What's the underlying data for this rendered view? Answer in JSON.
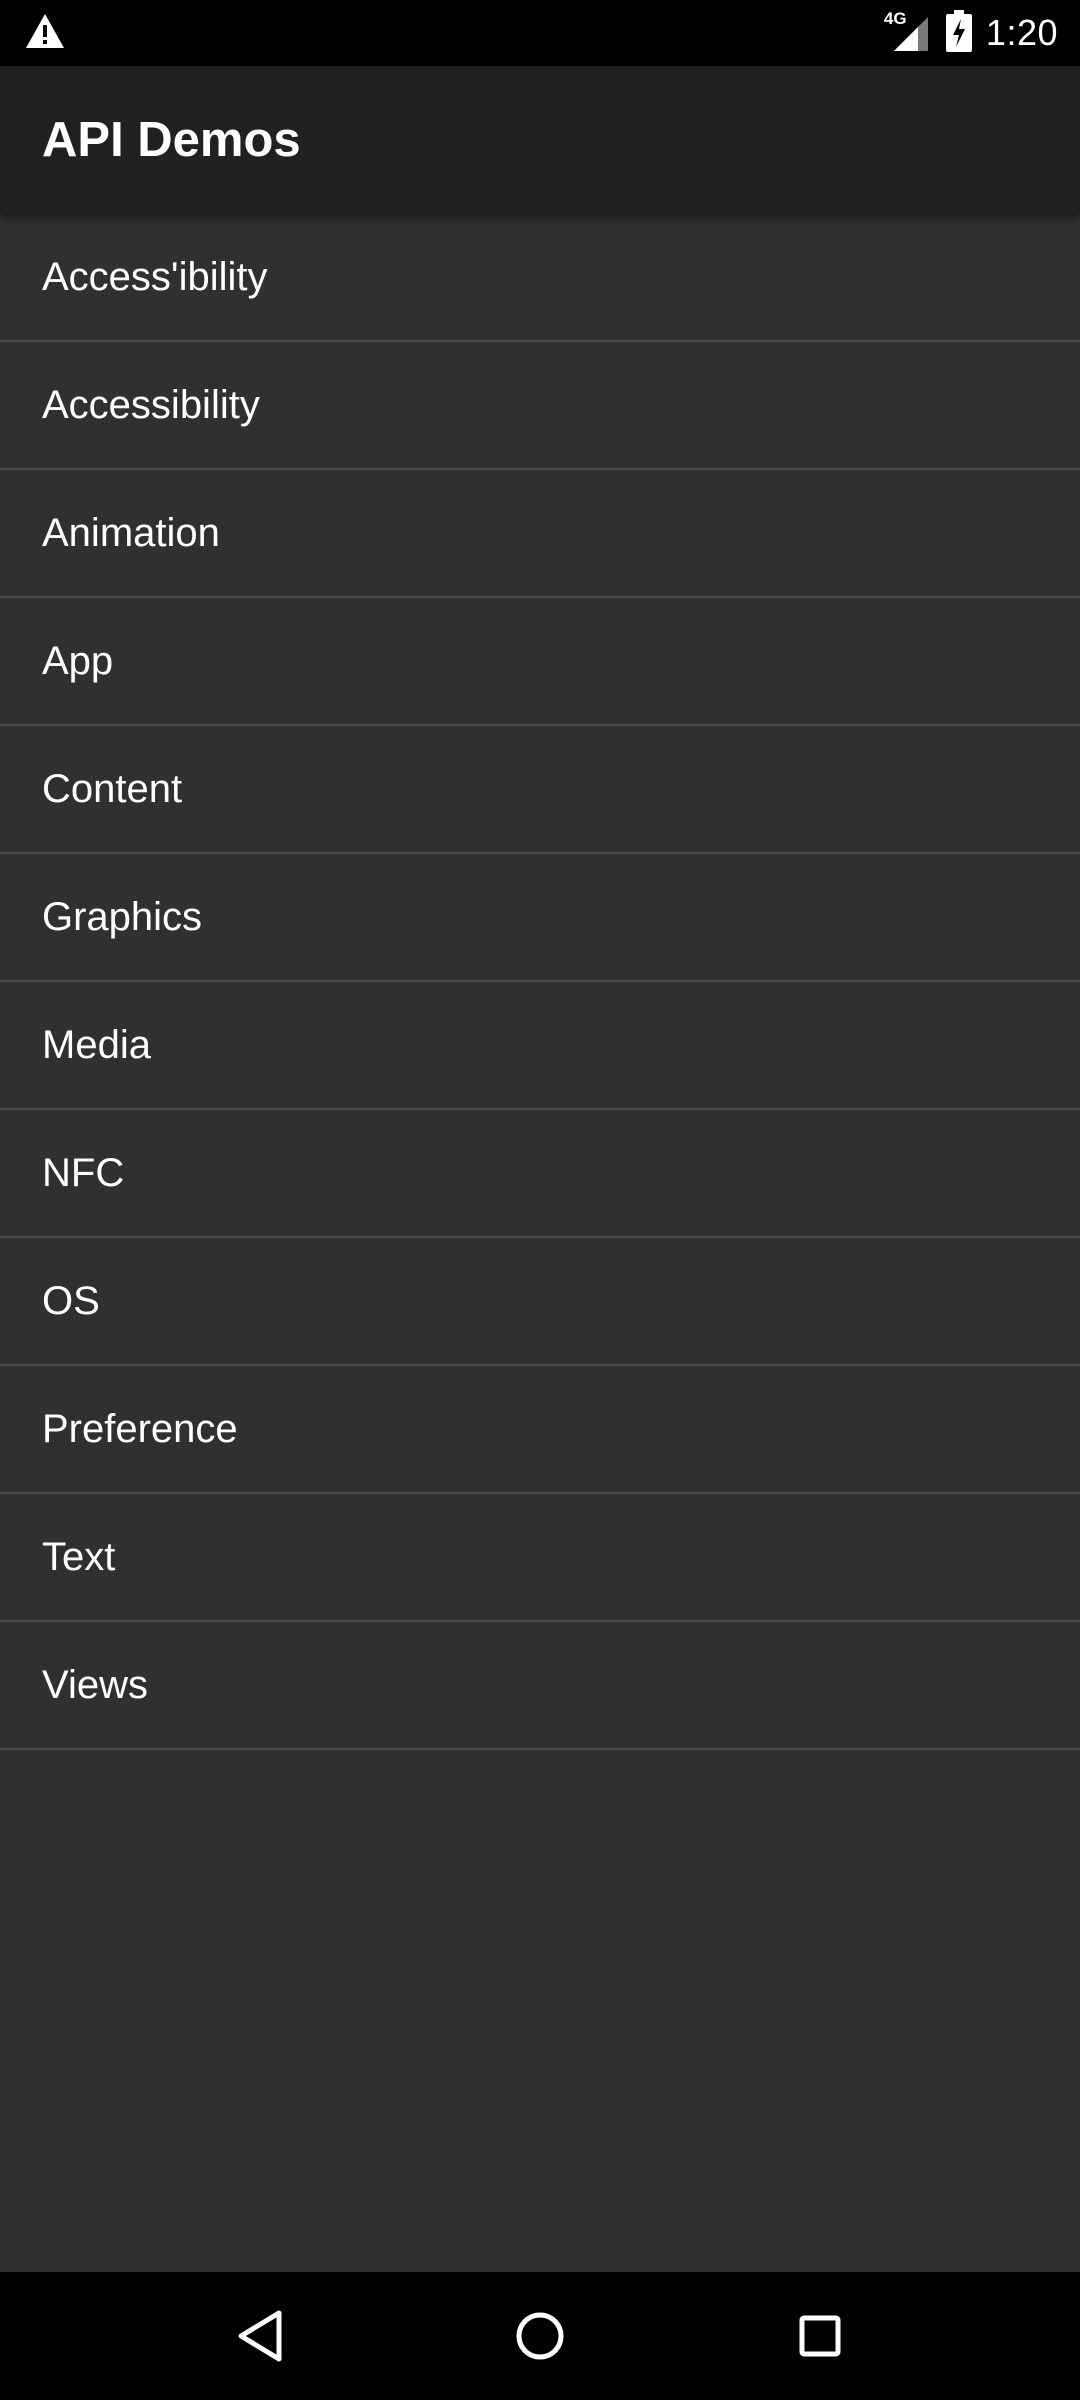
{
  "status_bar": {
    "network_type": "4G",
    "time": "1:20",
    "icons": [
      "warning-icon",
      "signal-icon",
      "battery-charging-icon"
    ]
  },
  "app_bar": {
    "title": "API Demos"
  },
  "list": {
    "items": [
      {
        "label": "Access'ibility"
      },
      {
        "label": "Accessibility"
      },
      {
        "label": "Animation"
      },
      {
        "label": "App"
      },
      {
        "label": "Content"
      },
      {
        "label": "Graphics"
      },
      {
        "label": "Media"
      },
      {
        "label": "NFC"
      },
      {
        "label": "OS"
      },
      {
        "label": "Preference"
      },
      {
        "label": "Text"
      },
      {
        "label": "Views"
      }
    ]
  },
  "nav_bar": {
    "icons": [
      "back-icon",
      "home-icon",
      "recents-icon"
    ]
  },
  "colors": {
    "background": "#303030",
    "app_bar": "#212121",
    "status_bar": "#000000",
    "divider": "#4a4a4a",
    "text": "#ffffff"
  }
}
